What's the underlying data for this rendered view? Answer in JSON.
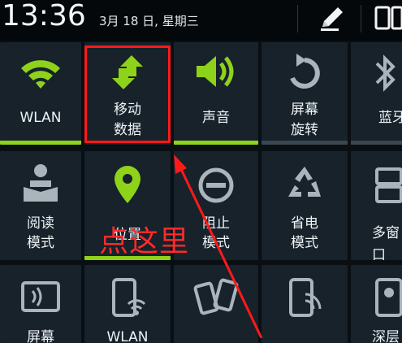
{
  "status_bar": {
    "time": "13:36",
    "date": "3月 18 日, 星期三"
  },
  "tiles": {
    "wlan": {
      "label": "WLAN",
      "active": true,
      "icon": "wifi-icon"
    },
    "mobile_data": {
      "label_line1": "移动",
      "label_line2": "数据",
      "active": false,
      "icon": "mobile-data-icon"
    },
    "sound": {
      "label": "声音",
      "active": true,
      "icon": "speaker-icon"
    },
    "rotate": {
      "label_line1": "屏幕",
      "label_line2": "旋转",
      "active": false,
      "icon": "rotate-icon"
    },
    "bluetooth": {
      "label": "蓝牙",
      "active": false,
      "icon": "bluetooth-icon"
    },
    "reading": {
      "label_line1": "阅读",
      "label_line2": "模式",
      "active": false,
      "icon": "reading-mode-icon"
    },
    "location": {
      "label": "位置",
      "active": true,
      "icon": "location-pin-icon"
    },
    "dnd": {
      "label_line1": "阻止",
      "label_line2": "模式",
      "active": false,
      "icon": "block-mode-icon"
    },
    "power_saving": {
      "label_line1": "省电",
      "label_line2": "模式",
      "active": false,
      "icon": "recycle-icon"
    },
    "multi_window": {
      "label": "多窗口",
      "active": false,
      "icon": "multi-window-icon"
    },
    "screen_mirror": {
      "label": "屏幕",
      "icon": "screen-mirroring-icon"
    },
    "wlan_hotspot": {
      "label": "WLAN",
      "icon": "wlan-hotspot-icon"
    },
    "sbeam": {
      "icon": "s-beam-icon"
    },
    "nfc": {
      "icon": "nfc-icon"
    },
    "smart_stay": {
      "label": "深层",
      "icon": "smart-stay-icon"
    }
  },
  "annotation": {
    "text": "点这里",
    "color": "#ff1a1a"
  },
  "colors": {
    "accent_green": "#8ed21a",
    "tile_bg": "#17222b",
    "background": "#0a0f14"
  }
}
